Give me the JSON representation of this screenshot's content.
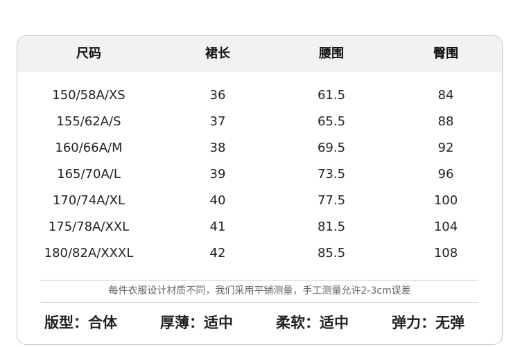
{
  "table": {
    "headers": [
      "尺码",
      "裙长",
      "腰围",
      "臀围"
    ],
    "rows": [
      [
        "150/58A/XS",
        "36",
        "61.5",
        "84"
      ],
      [
        "155/62A/S",
        "37",
        "65.5",
        "88"
      ],
      [
        "160/66A/M",
        "38",
        "69.5",
        "92"
      ],
      [
        "165/70A/L",
        "39",
        "73.5",
        "96"
      ],
      [
        "170/74A/XL",
        "40",
        "77.5",
        "100"
      ],
      [
        "175/78A/XXL",
        "41",
        "81.5",
        "104"
      ],
      [
        "180/82A/XXXL",
        "42",
        "85.5",
        "108"
      ]
    ]
  },
  "note": "每件衣服设计材质不同，我们采用平铺测量，手工测量允许2-3cm误差",
  "attributes": [
    "版型：合体",
    "厚薄：适中",
    "柔软：适中",
    "弹力：无弹"
  ]
}
